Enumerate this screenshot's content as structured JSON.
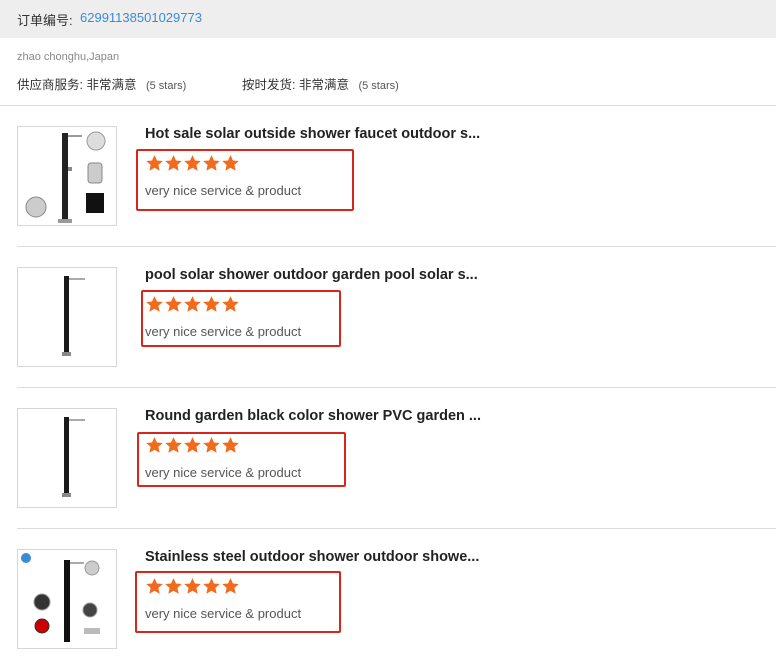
{
  "order": {
    "label": "订单编号:",
    "number": "62991138501029773"
  },
  "buyer": "zhao chonghu,Japan",
  "ratings": [
    {
      "label": "供应商服务:",
      "value": "非常满意",
      "stars_text": "(5 stars)"
    },
    {
      "label": "按时发货:",
      "value": "非常满意",
      "stars_text": "(5 stars)"
    }
  ],
  "colors": {
    "star": "#f26b1d",
    "highlight_box": "#d9261c",
    "order_number": "#3a8ad6"
  },
  "items": [
    {
      "title": "Hot sale solar outside shower faucet outdoor s...",
      "stars": 5,
      "comment": "very nice service & product",
      "thumbnail": "shower-with-accessories-image"
    },
    {
      "title": "pool solar shower outdoor garden pool solar s...",
      "stars": 5,
      "comment": "very nice service & product",
      "thumbnail": "shower-column-image"
    },
    {
      "title": "Round garden black color shower PVC garden ...",
      "stars": 5,
      "comment": "very nice service & product",
      "thumbnail": "shower-column-image"
    },
    {
      "title": "Stainless steel outdoor shower outdoor showe...",
      "stars": 5,
      "comment": "very nice service & product",
      "thumbnail": "shower-with-accessories-image"
    }
  ]
}
